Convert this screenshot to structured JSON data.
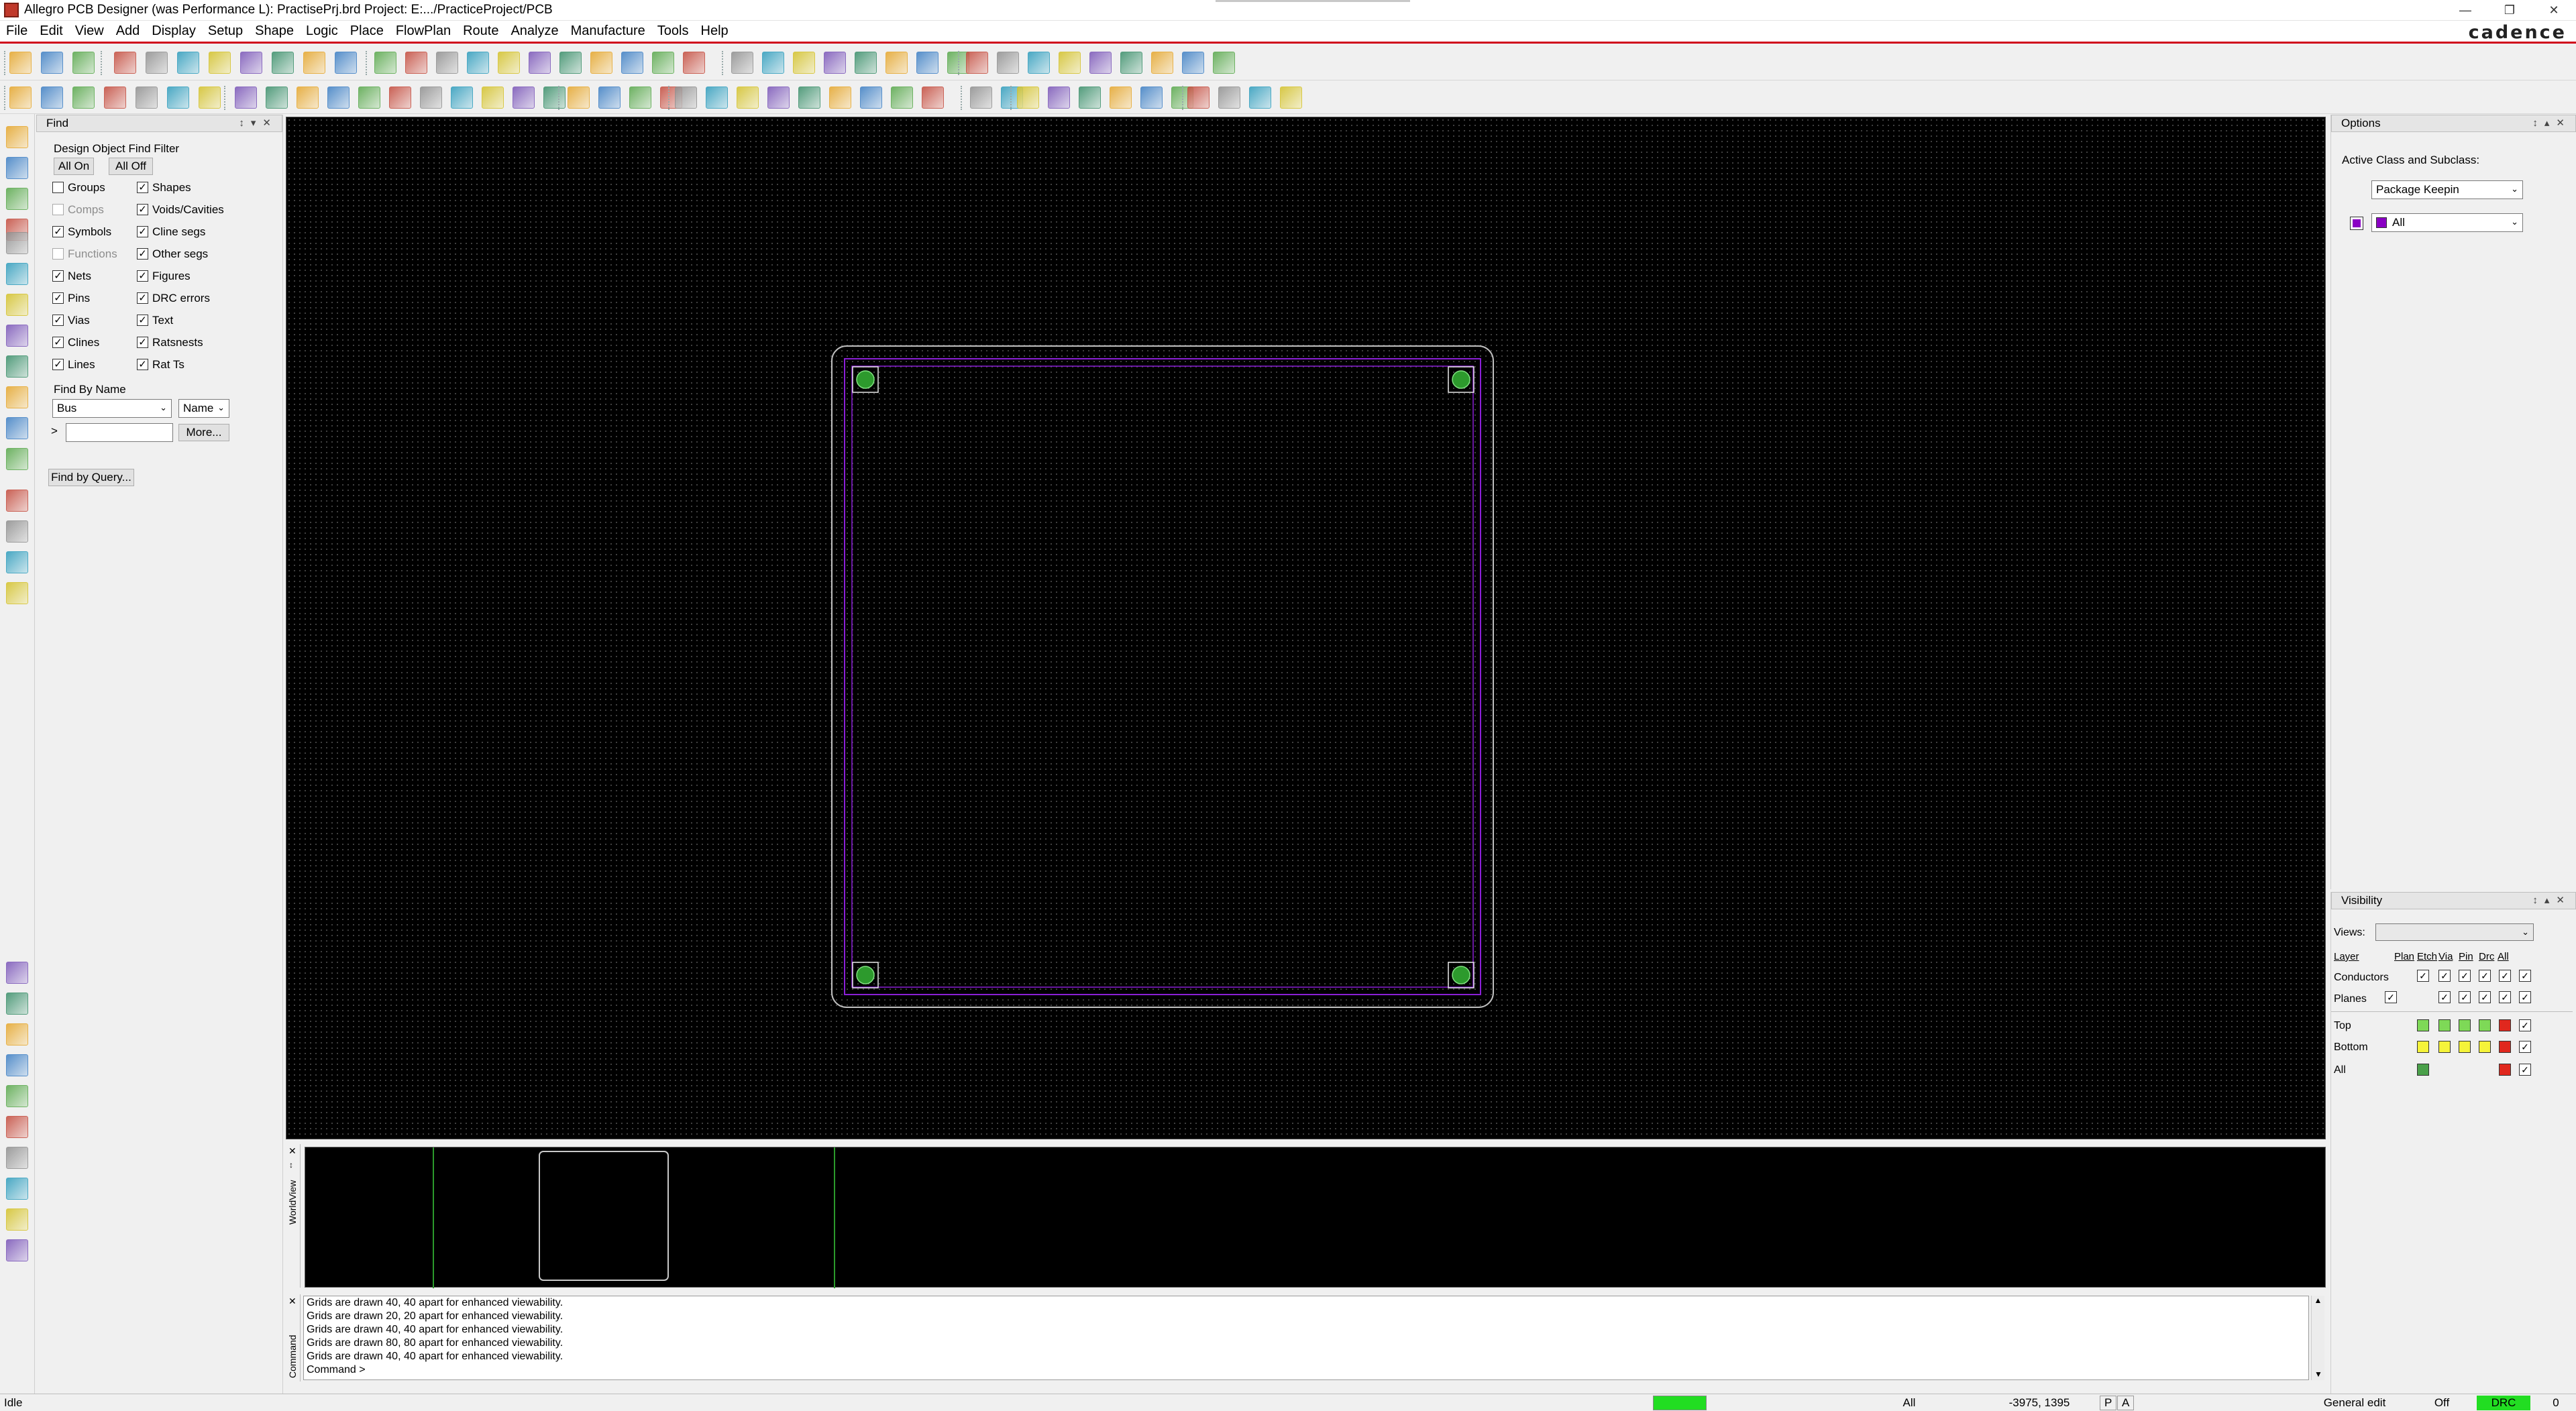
{
  "window": {
    "title": "Allegro PCB Designer (was Performance L): PractisePrj.brd  Project: E:.../PracticeProject/PCB",
    "controls": [
      "minimize-icon",
      "maximize-icon",
      "close-icon"
    ]
  },
  "menu": {
    "items": [
      "File",
      "Edit",
      "View",
      "Add",
      "Display",
      "Setup",
      "Shape",
      "Logic",
      "Place",
      "FlowPlan",
      "Route",
      "Analyze",
      "Manufacture",
      "Tools",
      "Help"
    ],
    "brand": "cadence"
  },
  "find": {
    "header": "Find",
    "filter_title": "Design Object Find Filter",
    "all_on": "All On",
    "all_off": "All Off",
    "left_items": [
      {
        "label": "Groups",
        "checked": false,
        "enabled": true
      },
      {
        "label": "Comps",
        "checked": false,
        "enabled": false
      },
      {
        "label": "Symbols",
        "checked": true,
        "enabled": true
      },
      {
        "label": "Functions",
        "checked": false,
        "enabled": false
      },
      {
        "label": "Nets",
        "checked": true,
        "enabled": true
      },
      {
        "label": "Pins",
        "checked": true,
        "enabled": true
      },
      {
        "label": "Vias",
        "checked": true,
        "enabled": true
      },
      {
        "label": "Clines",
        "checked": true,
        "enabled": true
      },
      {
        "label": "Lines",
        "checked": true,
        "enabled": true
      }
    ],
    "right_items": [
      {
        "label": "Shapes",
        "checked": true
      },
      {
        "label": "Voids/Cavities",
        "checked": true
      },
      {
        "label": "Cline segs",
        "checked": true
      },
      {
        "label": "Other segs",
        "checked": true
      },
      {
        "label": "Figures",
        "checked": true
      },
      {
        "label": "DRC errors",
        "checked": true
      },
      {
        "label": "Text",
        "checked": true
      },
      {
        "label": "Ratsnests",
        "checked": true
      },
      {
        "label": "Rat Ts",
        "checked": true
      }
    ],
    "by_name_title": "Find By Name",
    "type_select": "Bus",
    "name_select": "Name",
    "prompt": ">",
    "name_input": "",
    "more_button": "More...",
    "query_button": "Find by Query..."
  },
  "options": {
    "header": "Options",
    "active_class_label": "Active Class and Subclass:",
    "class_select": "Package Keepin",
    "subclass_select": "All",
    "subclass_color": "#8a00c4"
  },
  "visibility": {
    "header": "Visibility",
    "views_label": "Views:",
    "views_value": "",
    "columns": [
      "Layer",
      "Plan",
      "Etch",
      "Via",
      "Pin",
      "Drc",
      "All"
    ],
    "group_rows": [
      {
        "label": "Conductors"
      },
      {
        "label": "Planes"
      }
    ],
    "layer_rows": [
      {
        "label": "Top",
        "color": "#7ed957"
      },
      {
        "label": "Bottom",
        "color": "#f5f33a"
      },
      {
        "label": "All",
        "color": "#4aa04a"
      }
    ],
    "drc_color": "#e0281e"
  },
  "worldview": {
    "label": "WorldView"
  },
  "command": {
    "label": "Command",
    "lines": [
      "Grids are drawn 40, 40 apart for enhanced viewability.",
      "Grids are drawn 20, 20 apart for enhanced viewability.",
      "Grids are drawn 40, 40 apart for enhanced viewability.",
      "Grids are drawn 80, 80 apart for enhanced viewability.",
      "Grids are drawn 40, 40 apart for enhanced viewability.",
      "Command >"
    ]
  },
  "status": {
    "state": "Idle",
    "active_class": "All",
    "coordinates": "-3975, 1395",
    "p_flag": "P",
    "a_flag": "A",
    "mode": "General edit",
    "off": "Off",
    "drc": "DRC",
    "drc_count": "0",
    "progress_color": "#22dd22",
    "drc_color": "#22dd22"
  },
  "board": {
    "outline_color": "#bfbfbf",
    "keepin_color": "#8a1fd6",
    "pad_color": "#2d9a2d"
  }
}
